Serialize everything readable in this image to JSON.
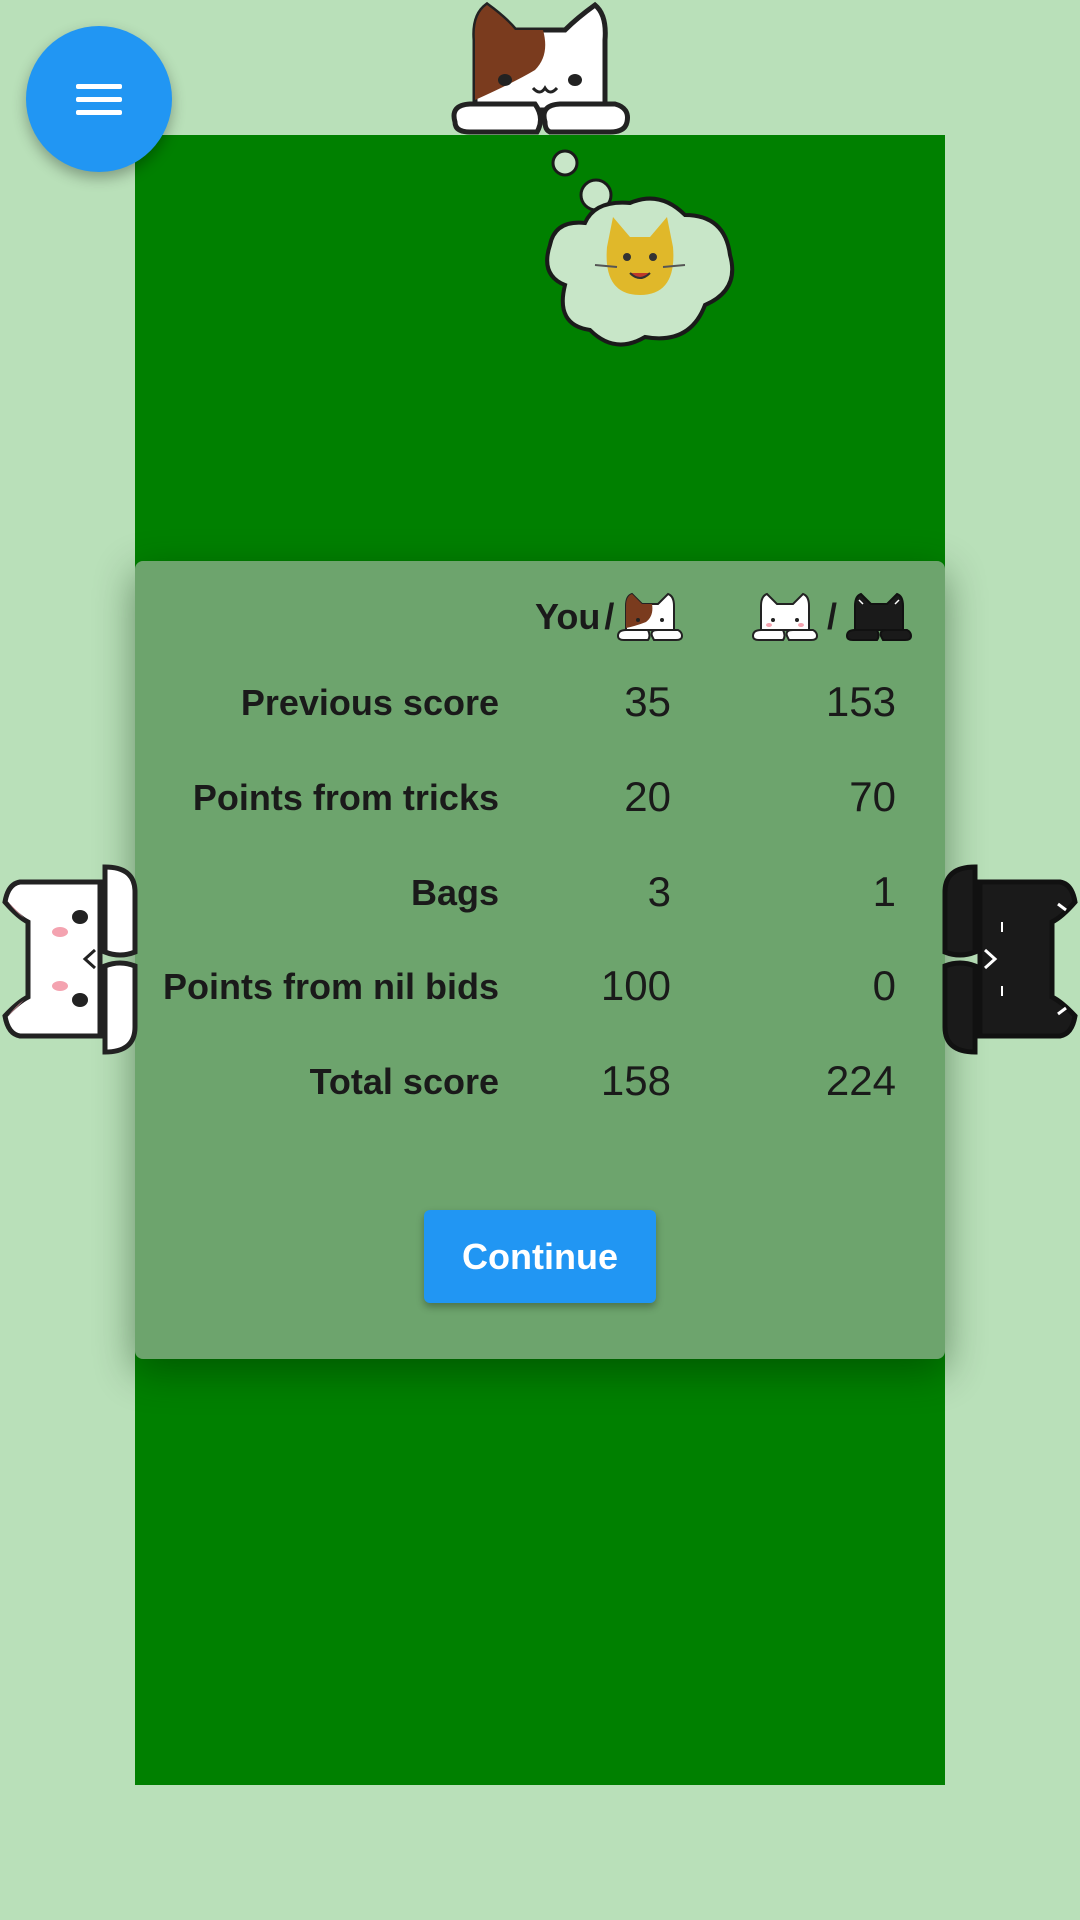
{
  "header": {
    "you_label": "You",
    "separator": "/",
    "partner_icon": "calico-cat-icon",
    "opponent_icons": [
      "white-cat-icon",
      "black-cat-icon"
    ]
  },
  "score_table": {
    "rows": [
      {
        "label": "Previous score",
        "you": "35",
        "opponents": "153"
      },
      {
        "label": "Points from tricks",
        "you": "20",
        "opponents": "70"
      },
      {
        "label": "Bags",
        "you": "3",
        "opponents": "1"
      },
      {
        "label": "Points from nil bids",
        "you": "100",
        "opponents": "0"
      },
      {
        "label": "Total score",
        "you": "158",
        "opponents": "224"
      }
    ]
  },
  "continue_label": "Continue",
  "thought_bubble": {
    "icon": "tabby-cat-face-icon"
  },
  "colors": {
    "background": "#b9e0b9",
    "table": "#008000",
    "panel": "#6da46d",
    "accent": "#2196f3"
  }
}
